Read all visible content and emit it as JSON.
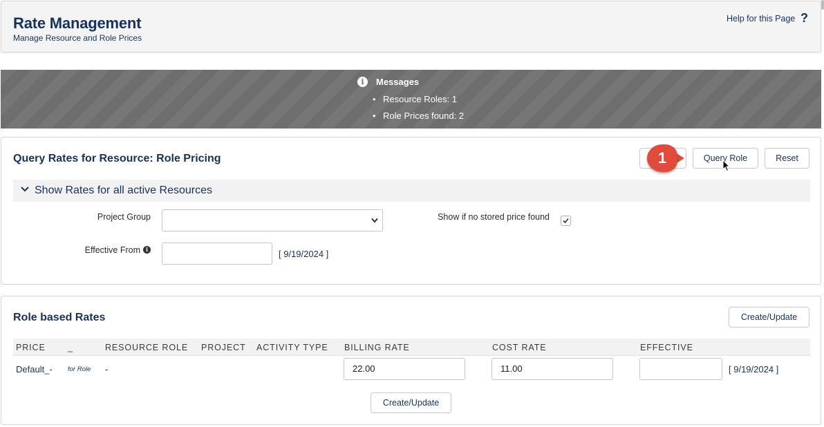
{
  "header": {
    "title": "Rate Management",
    "subtitle": "Manage Resource and Role Prices",
    "help_label": "Help for this Page",
    "help_icon": "?"
  },
  "messages": {
    "title": "Messages",
    "info_icon": "i",
    "items": [
      "Resource Roles: 1",
      "Role Prices found: 2"
    ]
  },
  "query": {
    "title": "Query Rates for Resource: Role Pricing",
    "buttons": {
      "hidden_label": "",
      "query_role": "Query Role",
      "reset": "Reset"
    },
    "section_label": "Show Rates for all active Resources",
    "project_group_label": "Project Group",
    "project_group_value": "",
    "show_if_no_price_label": "Show if no stored price found",
    "show_if_no_price_checked": true,
    "effective_from_label": "Effective From",
    "effective_from_value": "",
    "effective_from_default": "[ 9/19/2024 ]"
  },
  "annotation": {
    "badge_number": "1",
    "badge_color": "#e24a3b"
  },
  "rates": {
    "title": "Role based Rates",
    "create_update_label": "Create/Update",
    "columns": [
      "PRICE",
      "_",
      "RESOURCE ROLE",
      "PROJECT",
      "ACTIVITY TYPE",
      "BILLING RATE",
      "COST RATE",
      "EFFECTIVE"
    ],
    "rows": [
      {
        "price": "Default_-",
        "for_role": "for Role",
        "resource_role": "-",
        "project": "",
        "activity_type": "",
        "billing_rate": "22.00",
        "cost_rate": "11.00",
        "effective": "",
        "effective_default": "[ 9/19/2024 ]"
      }
    ],
    "bottom_button_label": "Create/Update"
  },
  "colors": {
    "brand_navy": "#16325c",
    "messages_bg": "#6e6e6e",
    "panel_border": "#d4d4d4"
  }
}
